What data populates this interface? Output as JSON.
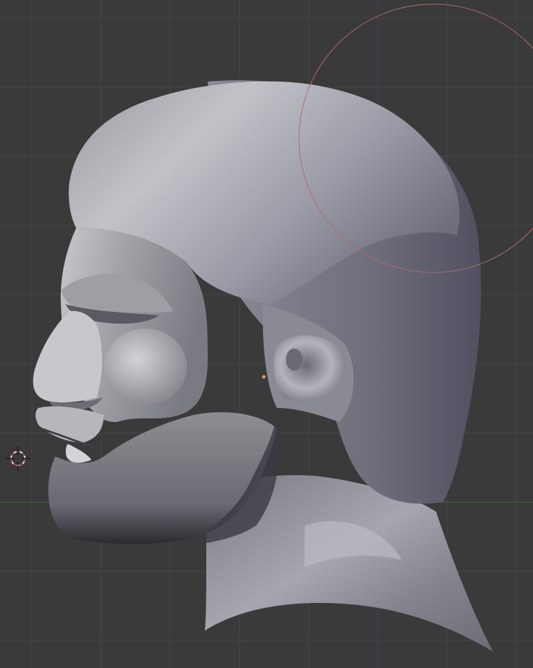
{
  "viewport": {
    "background_color": "#3a3a3a",
    "grid_color": "#454545",
    "x_axis_color": "#3d6a3d",
    "y_axis_color": "#3c3c78"
  },
  "mesh": {
    "object": "sculpted-head-profile",
    "base_color": "#8f8f99",
    "highlight_color": "#c4c4ca",
    "shadow_color": "#55555f"
  },
  "brush": {
    "icon": "brush-radius-circle",
    "color": "#b26a6a"
  },
  "cursor_3d": {
    "icon": "3d-cursor-crosshair",
    "color": "#c8c8c8",
    "ring_color": "#b04a4a"
  },
  "origin": {
    "icon": "object-origin-dot",
    "color": "#e39a5a"
  }
}
